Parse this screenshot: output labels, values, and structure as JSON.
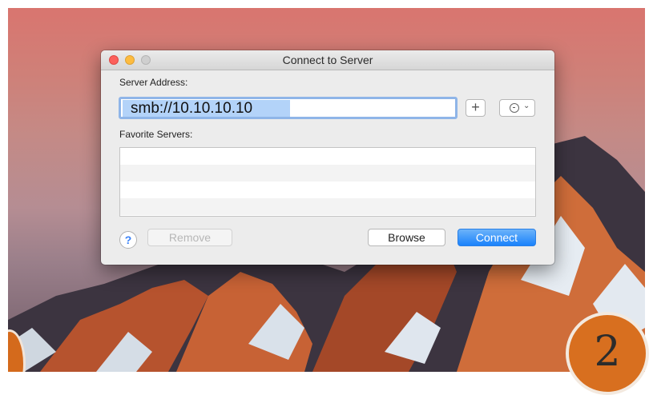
{
  "dialog": {
    "title": "Connect to Server",
    "server_address_label": "Server Address:",
    "server_address_value": "smb://10.10.10.10",
    "add_button_label": "+",
    "favorite_servers_label": "Favorite Servers:",
    "favorites": [
      "",
      "",
      "",
      ""
    ],
    "help_label": "?",
    "remove_label": "Remove",
    "browse_label": "Browse",
    "connect_label": "Connect",
    "recent_servers_icon": "clock-icon",
    "chevron_icon": "chevron-down-icon"
  },
  "overlay": {
    "step_number": "2"
  },
  "colors": {
    "accent": "#1a82fb",
    "selection": "#b3d3f9",
    "close": "#fc605c",
    "minimize": "#fdbc40",
    "badge": "#d86f1f"
  }
}
